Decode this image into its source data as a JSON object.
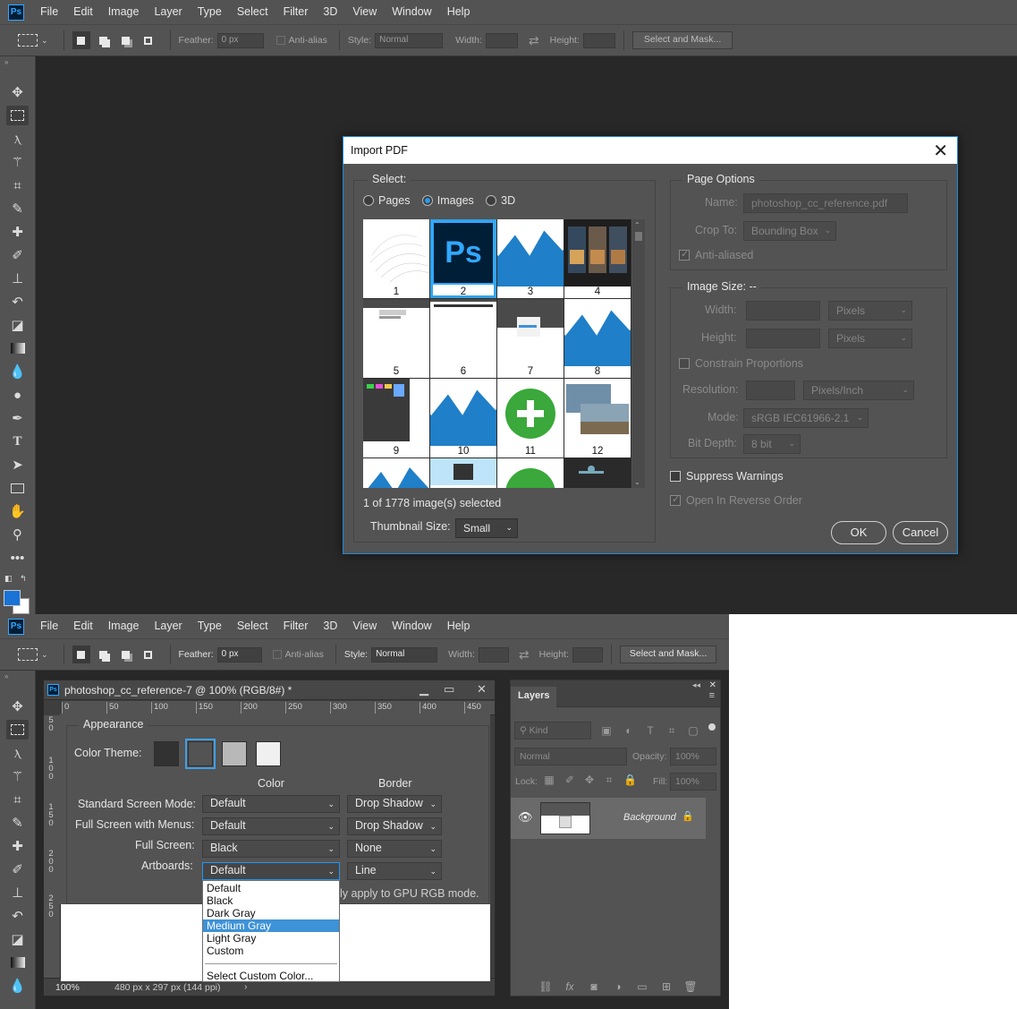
{
  "menubar": {
    "logo": "Ps",
    "items": [
      "File",
      "Edit",
      "Image",
      "Layer",
      "Type",
      "Select",
      "Filter",
      "3D",
      "View",
      "Window",
      "Help"
    ]
  },
  "options_top": {
    "feather_label": "Feather:",
    "feather_value": "0 px",
    "antialias_label": "Anti-alias",
    "style_label": "Style:",
    "style_value": "Normal",
    "width_label": "Width:",
    "height_label": "Height:",
    "select_mask_label": "Select and Mask..."
  },
  "options_bottom": {
    "feather_label": "Feather:",
    "feather_value": "0 px",
    "antialias_label": "Anti-alias",
    "style_label": "Style:",
    "style_value": "Normal",
    "width_label": "Width:",
    "height_label": "Height:",
    "select_mask_label": "Select and Mask..."
  },
  "colors": {
    "foreground": "#1a73d6",
    "background": "#ffffff",
    "accent": "#1c8ad8",
    "highlight": "#3e92d7"
  },
  "import_pdf": {
    "title": "Import PDF",
    "select_label": "Select:",
    "radio_pages": "Pages",
    "radio_images": "Images",
    "radio_3d": "3D",
    "selected_radio": "Images",
    "thumbnails": [
      {
        "num": "1",
        "icon": "sketch-thumb"
      },
      {
        "num": "2",
        "icon": "ps-logo-thumb"
      },
      {
        "num": "3",
        "icon": "wave-thumb"
      },
      {
        "num": "4",
        "icon": "phones-thumb"
      },
      {
        "num": "5",
        "icon": "screenshot-thumb"
      },
      {
        "num": "6",
        "icon": "text-thumb"
      },
      {
        "num": "7",
        "icon": "dialog-thumb"
      },
      {
        "num": "8",
        "icon": "wave-thumb"
      },
      {
        "num": "9",
        "icon": "panel-thumb"
      },
      {
        "num": "10",
        "icon": "wave-thumb"
      },
      {
        "num": "11",
        "icon": "plus-thumb"
      },
      {
        "num": "12",
        "icon": "photo-thumb"
      }
    ],
    "selected_thumb": "2",
    "selection_status": "1 of 1778 image(s) selected",
    "thumb_size_label": "Thumbnail Size:",
    "thumb_size_value": "Small",
    "page_options": {
      "title": "Page Options",
      "name_label": "Name:",
      "name_value": "photoshop_cc_reference.pdf",
      "crop_label": "Crop To:",
      "crop_value": "Bounding Box",
      "antialiased_label": "Anti-aliased"
    },
    "image_size": {
      "title": "Image Size: --",
      "width_label": "Width:",
      "width_unit": "Pixels",
      "height_label": "Height:",
      "height_unit": "Pixels",
      "constrain_label": "Constrain Proportions",
      "resolution_label": "Resolution:",
      "resolution_unit": "Pixels/Inch",
      "mode_label": "Mode:",
      "mode_value": "sRGB IEC61966-2.1",
      "bitdepth_label": "Bit Depth:",
      "bitdepth_value": "8 bit"
    },
    "suppress_warnings": "Suppress Warnings",
    "open_reverse": "Open In Reverse Order",
    "ok": "OK",
    "cancel": "Cancel"
  },
  "document": {
    "title": "photoshop_cc_reference-7 @ 100% (RGB/8#) *",
    "ruler_h": [
      "0",
      "50",
      "100",
      "150",
      "200",
      "250",
      "300",
      "350",
      "400",
      "450"
    ],
    "ruler_v": [
      "5",
      "0",
      "1",
      "0",
      "0",
      "1",
      "5",
      "0",
      "2",
      "0",
      "0",
      "2",
      "5",
      "0"
    ],
    "zoom": "100%",
    "doc_info": "480 px x 297 px (144 ppi)"
  },
  "appearance": {
    "section_title": "Appearance",
    "color_theme_label": "Color Theme:",
    "theme_swatches": [
      "#323232",
      "#535353",
      "#b8b8b8",
      "#f0f0f0"
    ],
    "selected_swatch": 1,
    "color_header": "Color",
    "border_header": "Border",
    "rows": [
      {
        "label": "Standard Screen Mode:",
        "color": "Default",
        "border": "Drop Shadow"
      },
      {
        "label": "Full Screen with Menus:",
        "color": "Default",
        "border": "Drop Shadow"
      },
      {
        "label": "Full Screen:",
        "color": "Black",
        "border": "None"
      },
      {
        "label": "Artboards:",
        "color": "Default",
        "border": "Line"
      }
    ],
    "note": "ly apply to GPU RGB mode.",
    "dropdown_options": [
      "Default",
      "Black",
      "Dark Gray",
      "Medium Gray",
      "Light Gray",
      "Custom"
    ],
    "highlighted_option": "Medium Gray",
    "custom_color_option": "Select Custom Color..."
  },
  "layers": {
    "tab_label": "Layers",
    "kind_label": "Kind",
    "blend_mode": "Normal",
    "opacity_label": "Opacity:",
    "opacity_value": "100%",
    "lock_label": "Lock:",
    "fill_label": "Fill:",
    "fill_value": "100%",
    "layer_name": "Background"
  }
}
